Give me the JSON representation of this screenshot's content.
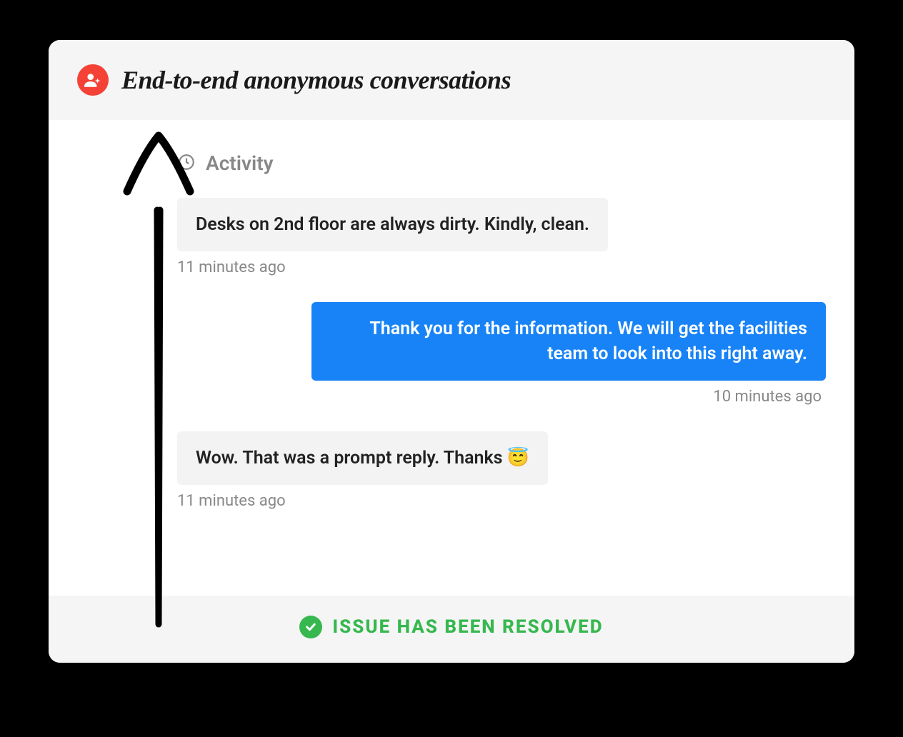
{
  "header": {
    "title": "End-to-end anonymous conversations",
    "icon": "anonymous-user-icon",
    "icon_bg": "#f44336"
  },
  "activity": {
    "label": "Activity",
    "icon": "clock-icon"
  },
  "messages": [
    {
      "side": "left",
      "text": "Desks on 2nd floor are always dirty. Kindly, clean.",
      "timestamp": "11 minutes ago"
    },
    {
      "side": "right",
      "text": "Thank you for the information. We will get the facilities team to look into this right away.",
      "timestamp": "10 minutes ago"
    },
    {
      "side": "left",
      "text": "Wow. That was a prompt reply. Thanks 😇",
      "timestamp": "11 minutes ago"
    }
  ],
  "footer": {
    "status_text": "ISSUE HAS BEEN RESOLVED",
    "status_icon": "check-circle-icon",
    "status_color": "#36b84e"
  },
  "annotation": {
    "arrow_icon": "hand-drawn-up-arrow"
  },
  "colors": {
    "bubble_left_bg": "#f3f3f3",
    "bubble_right_bg": "#1883f7",
    "header_bg": "#f5f5f5",
    "footer_bg": "#f5f5f5"
  }
}
